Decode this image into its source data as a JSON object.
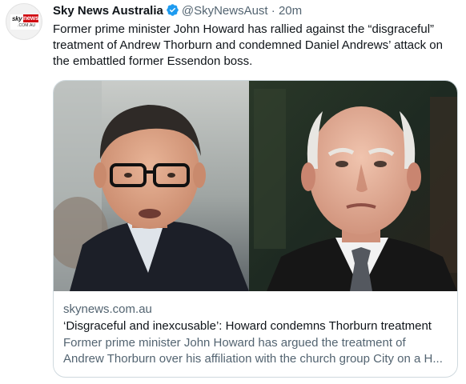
{
  "account": {
    "display_name": "Sky News Australia",
    "handle": "@SkyNewsAust",
    "separator": "·",
    "timestamp": "20m",
    "avatar_logo": {
      "sky": "sky",
      "news": "news",
      "sub": ".COM.AU"
    }
  },
  "tweet": {
    "text": "Former prime minister John Howard has rallied against the “disgraceful” treatment of Andrew Thorburn and condemned Daniel Andrews’ attack on the embattled former Essendon boss."
  },
  "card": {
    "domain": "skynews.com.au",
    "headline": "‘Disgraceful and inexcusable’: Howard condemns Thorburn treatment",
    "description": "Former prime minister John Howard has argued the treatment of Andrew Thorburn over his affiliation with the church group City on a H..."
  },
  "colors": {
    "text_primary": "#0f1419",
    "text_secondary": "#536471",
    "verified_blue": "#1d9bf0",
    "card_border": "#cfd9de",
    "brand_red": "#d10a11"
  },
  "icons": {
    "verified": "verified-badge-icon"
  }
}
